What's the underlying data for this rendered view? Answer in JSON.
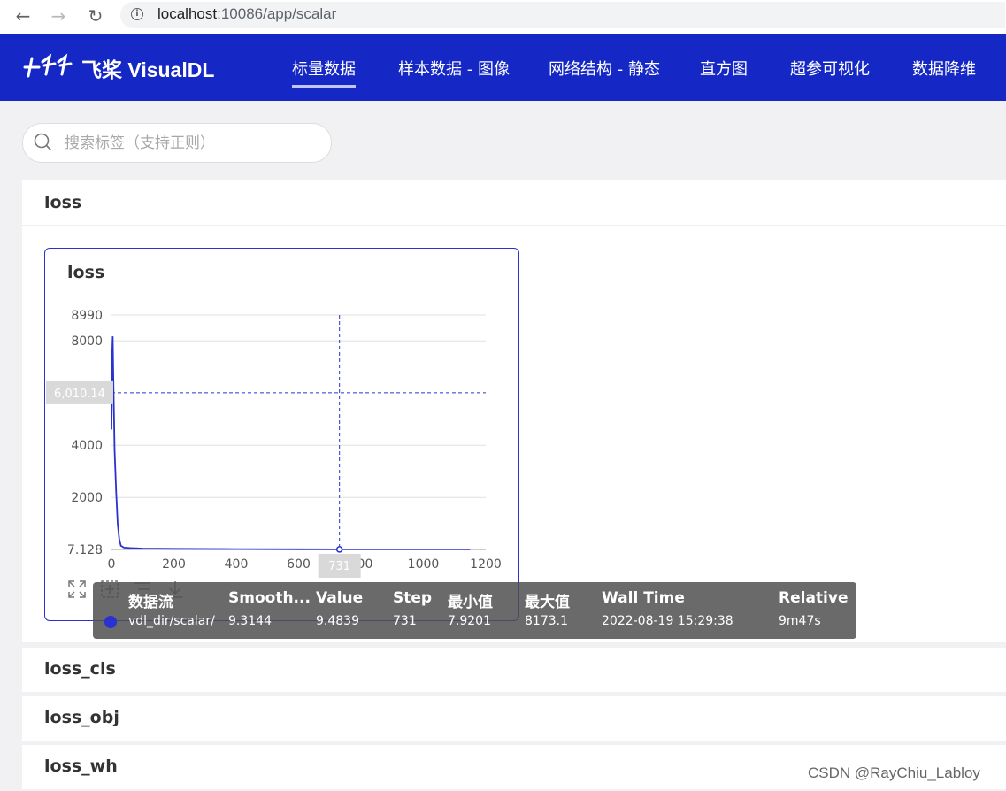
{
  "browser": {
    "url_host": "localhost",
    "url_rest": ":10086/app/scalar",
    "info_icon": "info-icon"
  },
  "header": {
    "logo_text": "飞桨 VisualDL",
    "nav": [
      "标量数据",
      "样本数据 - 图像",
      "网络结构 - 静态",
      "直方图",
      "超参可视化",
      "数据降维"
    ],
    "active_nav": 0,
    "brand_color": "#1527c5"
  },
  "search": {
    "placeholder": "搜索标签（支持正则）"
  },
  "groups": {
    "loss": {
      "title": "loss"
    },
    "loss_cls": {
      "title": "loss_cls"
    },
    "loss_obj": {
      "title": "loss_obj"
    },
    "loss_wh": {
      "title": "loss_wh"
    }
  },
  "card": {
    "title": "loss",
    "tools": [
      "fullscreen-icon",
      "select-icon",
      "legend-icon",
      "download-icon"
    ]
  },
  "chart_data": {
    "type": "line",
    "title": "loss",
    "xlabel": "",
    "ylabel": "",
    "xlim": [
      0,
      1200
    ],
    "ylim": [
      7.128,
      8990
    ],
    "x_ticks": [
      "0",
      "200",
      "400",
      "600",
      "800",
      "1000",
      "1200"
    ],
    "y_ticks": [
      "7.128",
      "2000",
      "4000",
      "8000",
      "8990"
    ],
    "y_tick_values": [
      7.128,
      2000,
      4000,
      8000,
      8990
    ],
    "series": [
      {
        "name": "vdl_dir/scalar/",
        "color": "#2932d1",
        "x": [
          0,
          2,
          4,
          6,
          8,
          10,
          15,
          20,
          25,
          30,
          40,
          60,
          100,
          200,
          400,
          600,
          731,
          800,
          1000,
          1150
        ],
        "y": [
          4600,
          7400,
          8173.1,
          6600,
          5200,
          3800,
          2200,
          1000,
          400,
          150,
          80,
          60,
          40,
          30,
          22,
          15,
          9.4839,
          12,
          10,
          9
        ]
      }
    ],
    "crosshair": {
      "x": 731,
      "x_label": "731",
      "y": 6010.14,
      "y_label": "6,010.14"
    },
    "grid": true
  },
  "tooltip": {
    "headers": [
      "数据流",
      "Smooth...",
      "Value",
      "Step",
      "最小值",
      "最大值",
      "Wall Time",
      "Relative"
    ],
    "row": [
      "vdl_dir/scalar/",
      "9.3144",
      "9.4839",
      "731",
      "7.9201",
      "8173.1",
      "2022-08-19 15:29:38",
      "9m47s"
    ]
  },
  "watermark": "CSDN @RayChiu_Labloy"
}
